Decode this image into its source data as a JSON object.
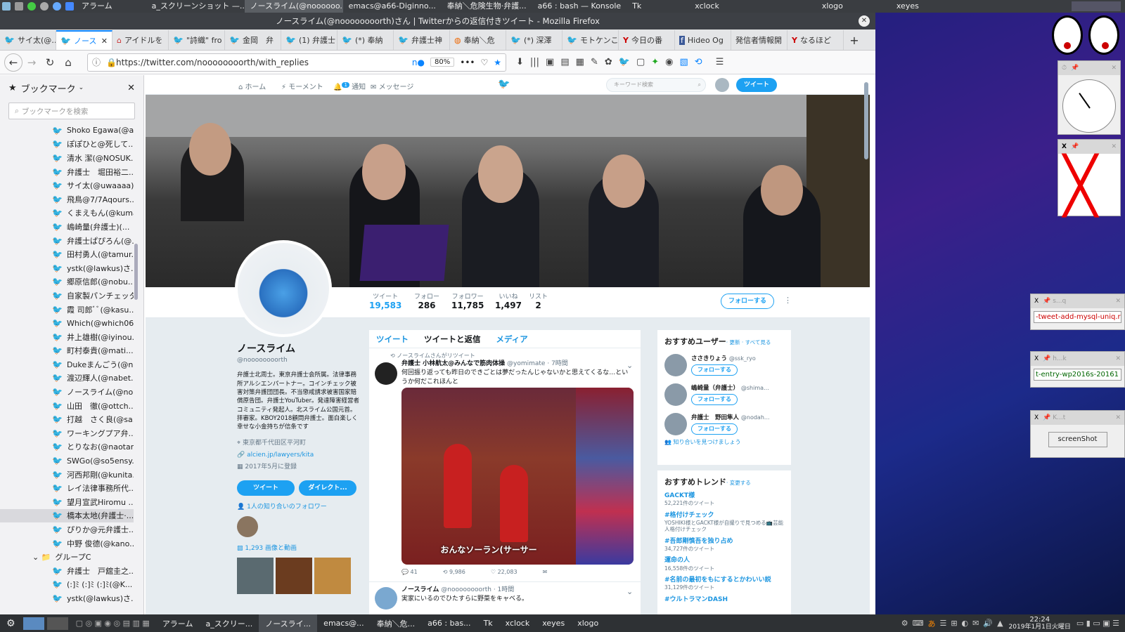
{
  "top_panel": {
    "tasks": [
      "アラーム",
      "a_スクリーンショット —...",
      "ノースライム(@noooooo...",
      "emacs@a66-Diginno...",
      "奉納＼危険生物·弁護...",
      "a66 : bash — Konsole",
      "Tk",
      "xclock",
      "xlogo",
      "xeyes"
    ]
  },
  "window_title": "ノースライム(@noooooooorth)さん | Twitterからの返信付きツイート - Mozilla Firefox",
  "tabs": [
    "サイ太(@…",
    "ノース",
    "アイドルを",
    "\"詩織\" fro",
    "金岡　弁",
    "(1) 弁護士",
    "(*) 奉納",
    "弁護士神",
    "奉納＼危",
    "(*) 深澤",
    "モトケンこ",
    "今日の番",
    "Hideo Og",
    "発信者情報開",
    "なるほど"
  ],
  "url": "https://twitter.com/noooooooorth/with_replies",
  "zoom": "80%",
  "sidebar": {
    "title": "ブックマーク",
    "search_placeholder": "ブックマークを検索",
    "items": [
      "Shoko Egawa(@a...",
      "ぽぽひと@死して...",
      "清水 潔(@NOSUK...",
      "弁護士　堀田裕二...",
      "サイ太(@uwaaaa)...",
      "飛鳥@7/7Aqours...",
      "くまえもん(@kuma...",
      "嶋崎量(弁護士)(...",
      "弁護士ぱぴろん(@...",
      "田村勇人(@tamur...",
      "ystk(@lawkus)さ...",
      "郷原信郎(@nobu...",
      "自家製パンチェッタ...",
      "霞 司郎ﾞﾞ(@kasu...",
      "Which(@which06...",
      "井上雄樹(@iyinou...",
      "町村泰貴(@mati...",
      "Dukeまんごう(@n...",
      "渡辺輝人(@nabet...",
      "ノースライム(@no...",
      "山田　徹(@ottch...",
      "打越　さく良(@sa...",
      "ワーキングプア弁...",
      "とりなお(@naotar...",
      "SWGo(@so5ensy...",
      "河西邦剛(@kunita...",
      "レイ法律事務所代...",
      "望月宣武Hiromu ...",
      "橋本太地(弁護士·...",
      "ぴりか@元弁護士...",
      "中野 俊德(@kano..."
    ],
    "selected_index": 28,
    "group_label": "グループC",
    "group_items": [
      "弁護士　戸舘圭之...",
      "(:]ﾐ (:]ﾐ (:]ﾐ(@K...",
      "ystk(@lawkus)さ..."
    ]
  },
  "twnav": {
    "home": "ホーム",
    "moments": "モーメント",
    "notifications": "通知",
    "notif_badge": "1",
    "messages": "メッセージ",
    "search_placeholder": "キーワード検索",
    "tweet_button": "ツイート"
  },
  "stats": [
    {
      "label": "ツイート",
      "value": "19,583"
    },
    {
      "label": "フォロー",
      "value": "286"
    },
    {
      "label": "フォロワー",
      "value": "11,785"
    },
    {
      "label": "いいね",
      "value": "1,497"
    },
    {
      "label": "リスト",
      "value": "2"
    }
  ],
  "follow_label": "フォローする",
  "profile": {
    "name": "ノースライム",
    "handle": "@noooooooorth",
    "bio": "弁護士北周士。東京弁護士会所属。法律事務所アルシエンパートナー。コインチェック被害対策弁護団団長。不当懲戒請求被害国家賠償原告団。弁護士YouTuber。発達障害経営者コミュニティ発起人。北スライム公国元首。拝審家。KBOY2018顧問弁護士。面白楽しく幸せな小金持ちが信条です",
    "location": "東京都千代田区平河町",
    "link": "alcien.jp/lawyers/kita",
    "joined": "2017年5月に登録",
    "btn_tweet": "ツイート",
    "btn_dm": "ダイレクト...",
    "followers_you_know": "1人の知り合いのフォロワー",
    "media_count": "1,293 画像と動画"
  },
  "timeline": {
    "tabs": [
      "ツイート",
      "ツイートと返信",
      "メディア"
    ],
    "retweet_note": "ノースライムさんがリツイート",
    "tweet1": {
      "name": "弁護士 小林航太@みんなで筋肉体操",
      "handle": "@yomimate",
      "time": "· 7時間",
      "text": "何回振り返っても昨日のできごとは夢だったんじゃないかと思えてくるな…というか何だこれほんと",
      "caption": "おんなソーラン(サーサー",
      "reply": "41",
      "rt": "9,986",
      "like": "22,083"
    },
    "tweet2": {
      "name": "ノースライム",
      "handle": "@noooooooorth",
      "time": "· 1時間",
      "text": "実家にいるのでひたすらに野菜をキャベる。"
    }
  },
  "suggested": {
    "title": "おすすめユーザー",
    "links": "· 更新 · すべて見る",
    "users": [
      {
        "name": "ささきりょう",
        "handle": "@ssk_ryo"
      },
      {
        "name": "嶋崎量（弁護士）",
        "handle": "@shima..."
      },
      {
        "name": "弁護士　野田隼人",
        "handle": "@nodah..."
      }
    ],
    "find_friends": "知り合いを見つけましょう"
  },
  "trends": {
    "title": "おすすめトレンド",
    "change": "· 変更する",
    "items": [
      {
        "tag": "GACKT様",
        "count": "52,221件のツイート",
        "desc": ""
      },
      {
        "tag": "#格付けチェック",
        "count": "",
        "desc": "YOSHIKI様とGACKT様が自撮りで見つめる📺芸能人格付けチェック"
      },
      {
        "tag": "#吾郎剛慎吾を独り占め",
        "count": "34,727件のツイート",
        "desc": ""
      },
      {
        "tag": "運命の人",
        "count": "16,558件のツイート",
        "desc": ""
      },
      {
        "tag": "#名前の最初をもにするとかわいい説",
        "count": "31,129件のツイート",
        "desc": ""
      },
      {
        "tag": "#ウルトラマンDASH",
        "count": "",
        "desc": ""
      }
    ]
  },
  "side_windows": {
    "win1": "-tweet-add-mysql-uniq.r",
    "win2": "t-entry-wp2016s-20161",
    "win3_btn": "screenShot"
  },
  "taskbar": {
    "tasks": [
      "アラーム",
      "a_スクリー...",
      "ノースライ...",
      "emacs@...",
      "奉納＼危...",
      "a66 : bas...",
      "Tk",
      "xclock",
      "xeyes",
      "xlogo"
    ],
    "time": "22:24",
    "date": "2019年1月1日火曜日"
  }
}
